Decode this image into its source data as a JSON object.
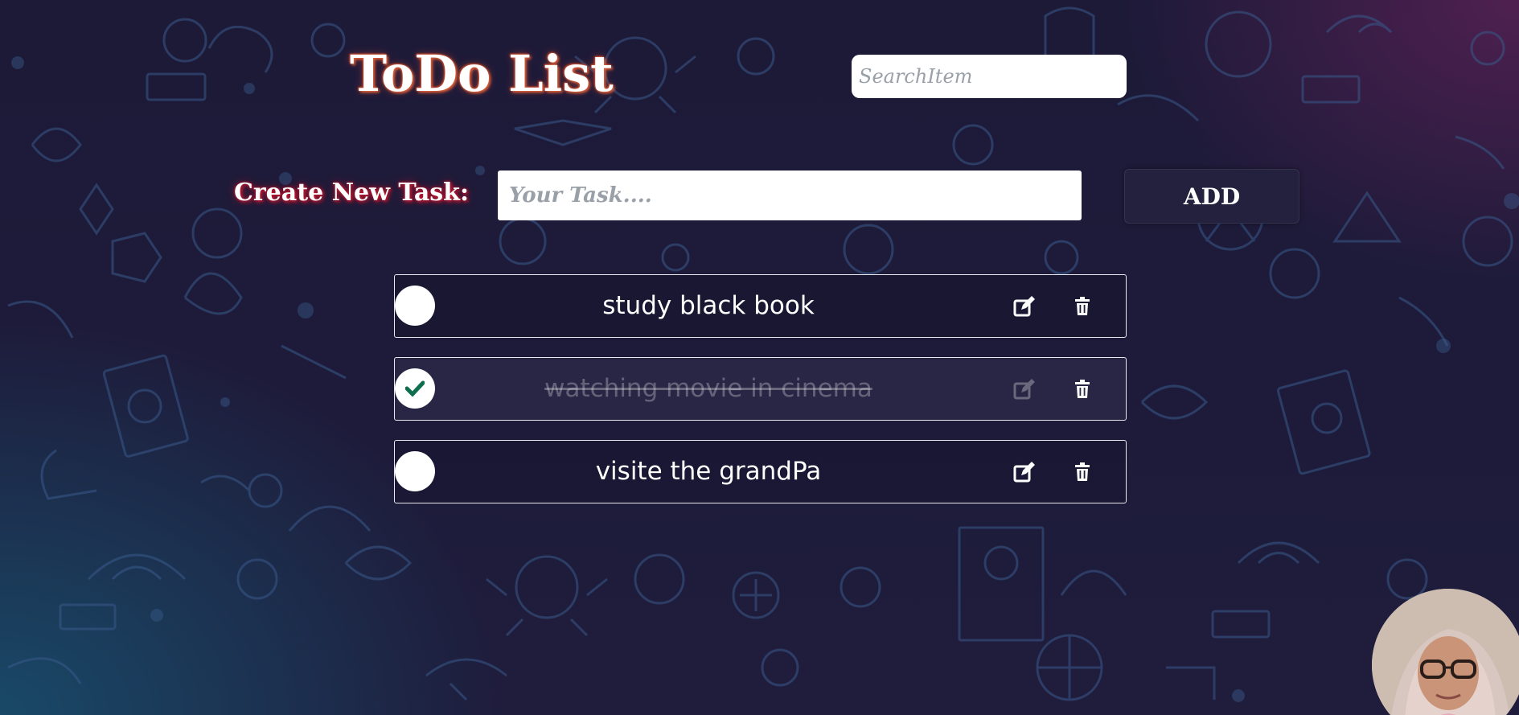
{
  "header": {
    "title": "ToDo List",
    "search_placeholder": "SearchItem"
  },
  "create": {
    "label": "Create New Task:",
    "input_placeholder": "Your Task....",
    "add_label": "ADD"
  },
  "tasks": [
    {
      "text": "study black book",
      "done": false
    },
    {
      "text": "watching movie in cinema",
      "done": true
    },
    {
      "text": "visite the grandPa",
      "done": false
    }
  ],
  "colors": {
    "background": "#1e1b3a",
    "title_glow": "#e0613a",
    "label_glow": "#c0182d",
    "check_mark": "#0f6e4d"
  },
  "icons": {
    "check": "check-icon",
    "edit": "edit-icon",
    "delete": "trash-icon"
  }
}
